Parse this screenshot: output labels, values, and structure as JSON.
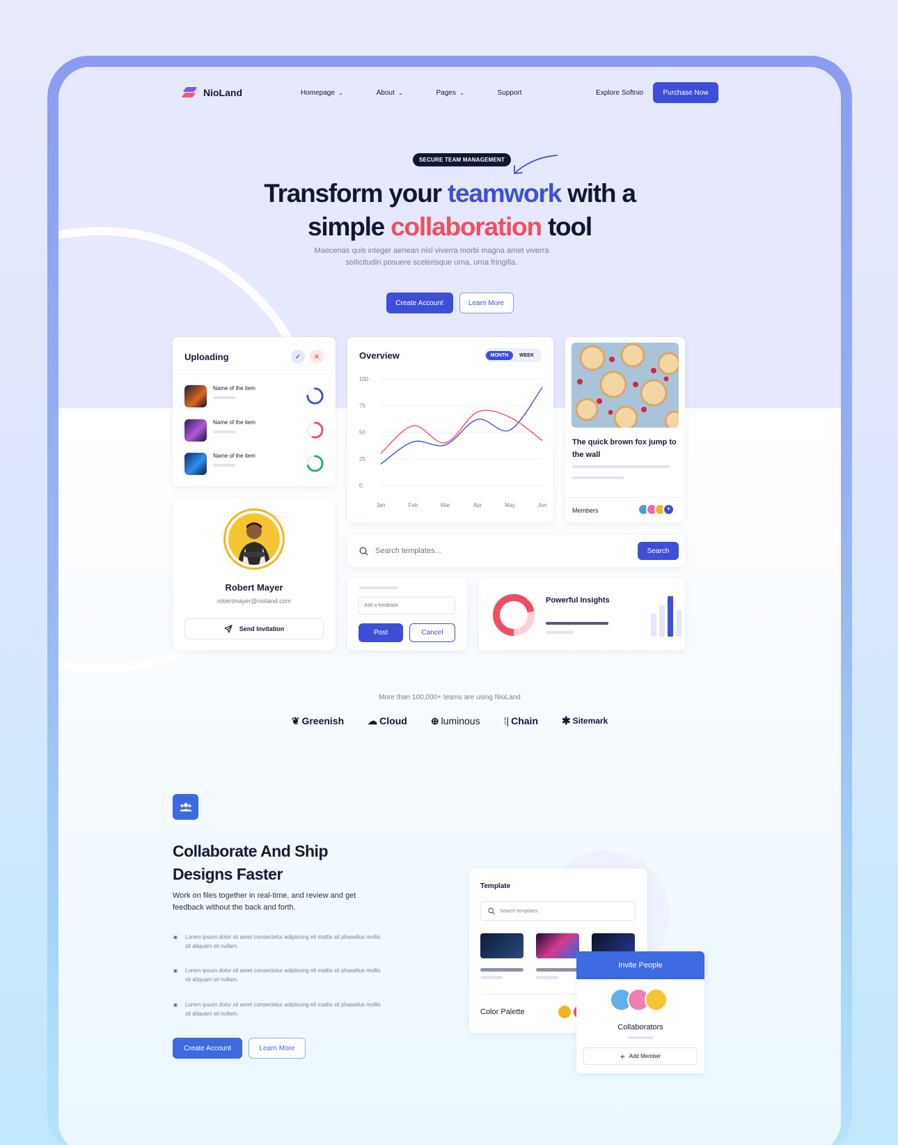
{
  "nav": {
    "brand": "NioLand",
    "links": [
      {
        "label": "Homepage",
        "dropdown": true
      },
      {
        "label": "About",
        "dropdown": true
      },
      {
        "label": "Pages",
        "dropdown": true
      },
      {
        "label": "Support",
        "dropdown": false
      }
    ],
    "explore": "Explore Softnio",
    "purchase": "Purchase Now"
  },
  "hero": {
    "badge": "SECURE TEAM MANAGEMENT",
    "title_a": "Transform your ",
    "title_b": "teamwork",
    "title_c": " with a",
    "title_d": "simple ",
    "title_e": "collaboration",
    "title_f": " tool",
    "subtitle": "Maecenas quis integer aenean nisl viverra morbi magna amet viverra sollicitudin posuere scelerisque urna, urna fringilla.",
    "primary_btn": "Create Account",
    "secondary_btn": "Learn More"
  },
  "uploading": {
    "title": "Uploading",
    "items": [
      {
        "name": "Name of the item",
        "progress": 0.75,
        "color": "#3d4fd8"
      },
      {
        "name": "Name of the item",
        "progress": 0.55,
        "color": "#ef4f63"
      },
      {
        "name": "Name of the item",
        "progress": 0.7,
        "color": "#22b55c"
      }
    ]
  },
  "profile": {
    "name": "Robert Mayer",
    "email": "robertmayer@nioland.com",
    "action": "Send Invitation"
  },
  "overview": {
    "title": "Overview",
    "toggle": [
      "MONTH",
      "WEEK"
    ],
    "active": "MONTH"
  },
  "chart_data": {
    "type": "line",
    "title": "Overview",
    "categories": [
      "Jan",
      "Feb",
      "Mar",
      "Apr",
      "May",
      "Jun"
    ],
    "ylim": [
      0,
      100
    ],
    "yticks": [
      100,
      75,
      50,
      25,
      0
    ],
    "grid": true,
    "series": [
      {
        "color": "#3d4fd8",
        "values": [
          20,
          41,
          38,
          62,
          52,
          92
        ]
      },
      {
        "color": "#ef4f63",
        "values": [
          30,
          56,
          40,
          69,
          64,
          42
        ]
      }
    ]
  },
  "article": {
    "title": "The quick brown fox jump to the wall",
    "members_label": "Members"
  },
  "search": {
    "placeholder": "Search templates...",
    "button": "Search"
  },
  "feedback": {
    "placeholder": "Add a feedback",
    "post": "Post",
    "cancel": "Cancel"
  },
  "insights": {
    "title": "Powerful Insights",
    "donut_fraction": 0.72
  },
  "social": {
    "caption": "More than 100,000+ teams are using NioLand",
    "brands": [
      "Greenish",
      "Cloud",
      "luminous",
      "Chain",
      "Sitemark"
    ]
  },
  "feature": {
    "title_1": "Collaborate And Ship",
    "title_2": "Designs Faster",
    "description": "Work on files together in real-time, and review and get feedback without the back and forth.",
    "bullets": [
      "Lorem ipsum dolor sit amet consectetur adipiscing eli mattis sit phasellus mollis sit aliquam sit nullam.",
      "Lorem ipsum dolor sit amet consectetur adipiscing eli mattis sit phasellus mollis sit aliquam sit nullam.",
      "Lorem ipsum dolor sit amet consectetur adipiscing eli mattis sit phasellus mollis sit aliquam sit nullam."
    ],
    "primary_btn": "Create Account",
    "secondary_btn": "Learn More"
  },
  "template": {
    "title": "Template",
    "search_placeholder": "Search templates .",
    "palette_label": "Color Palette"
  },
  "invite": {
    "header": "Invite People",
    "label": "Collaborators",
    "button": "Add Member"
  }
}
